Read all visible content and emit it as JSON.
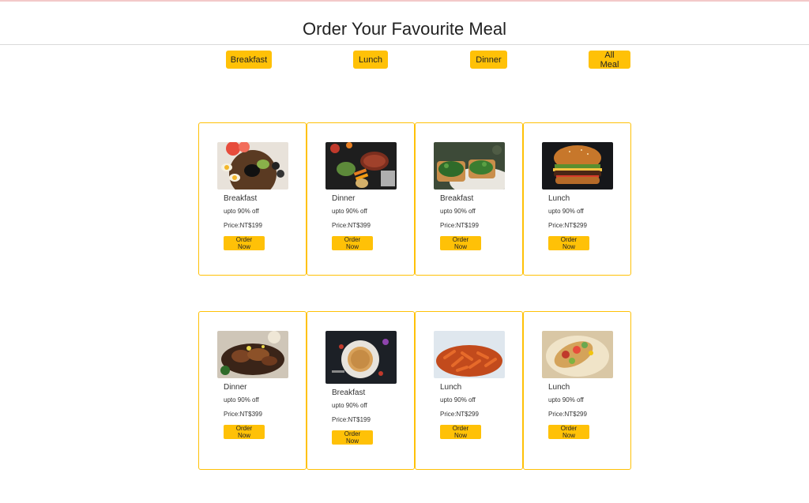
{
  "header": {
    "title": "Order Your Favourite Meal"
  },
  "filters": [
    "Breakfast",
    "Lunch",
    "Dinner",
    "All Meal"
  ],
  "rows": [
    [
      {
        "title": "Breakfast",
        "discount": "upto 90% off",
        "price": "Price:NT$199",
        "button": "Order Now",
        "image": "breakfast-plate-image"
      },
      {
        "title": "Dinner",
        "discount": "upto 90% off",
        "price": "Price:NT$399",
        "button": "Order Now",
        "image": "steak-dinner-image"
      },
      {
        "title": "Breakfast",
        "discount": "upto 90% off",
        "price": "Price:NT$199",
        "button": "Order Now",
        "image": "avocado-toast-image"
      },
      {
        "title": "Lunch",
        "discount": "upto 90% off",
        "price": "Price:NT$299",
        "button": "Order Now",
        "image": "burger-image"
      }
    ],
    [
      {
        "title": "Dinner",
        "discount": "upto 90% off",
        "price": "Price:NT$399",
        "button": "Order Now",
        "image": "grilled-meat-image"
      },
      {
        "title": "Breakfast",
        "discount": "upto 90% off",
        "price": "Price:NT$199",
        "button": "Order Now",
        "image": "pancake-image"
      },
      {
        "title": "Lunch",
        "discount": "upto 90% off",
        "price": "Price:NT$299",
        "button": "Order Now",
        "image": "pasta-image"
      },
      {
        "title": "Lunch",
        "discount": "upto 90% off",
        "price": "Price:NT$299",
        "button": "Order Now",
        "image": "taco-image"
      }
    ]
  ],
  "colors": {
    "accent": "#ffc107",
    "card_border": "#ffc107",
    "text": "#333333"
  }
}
